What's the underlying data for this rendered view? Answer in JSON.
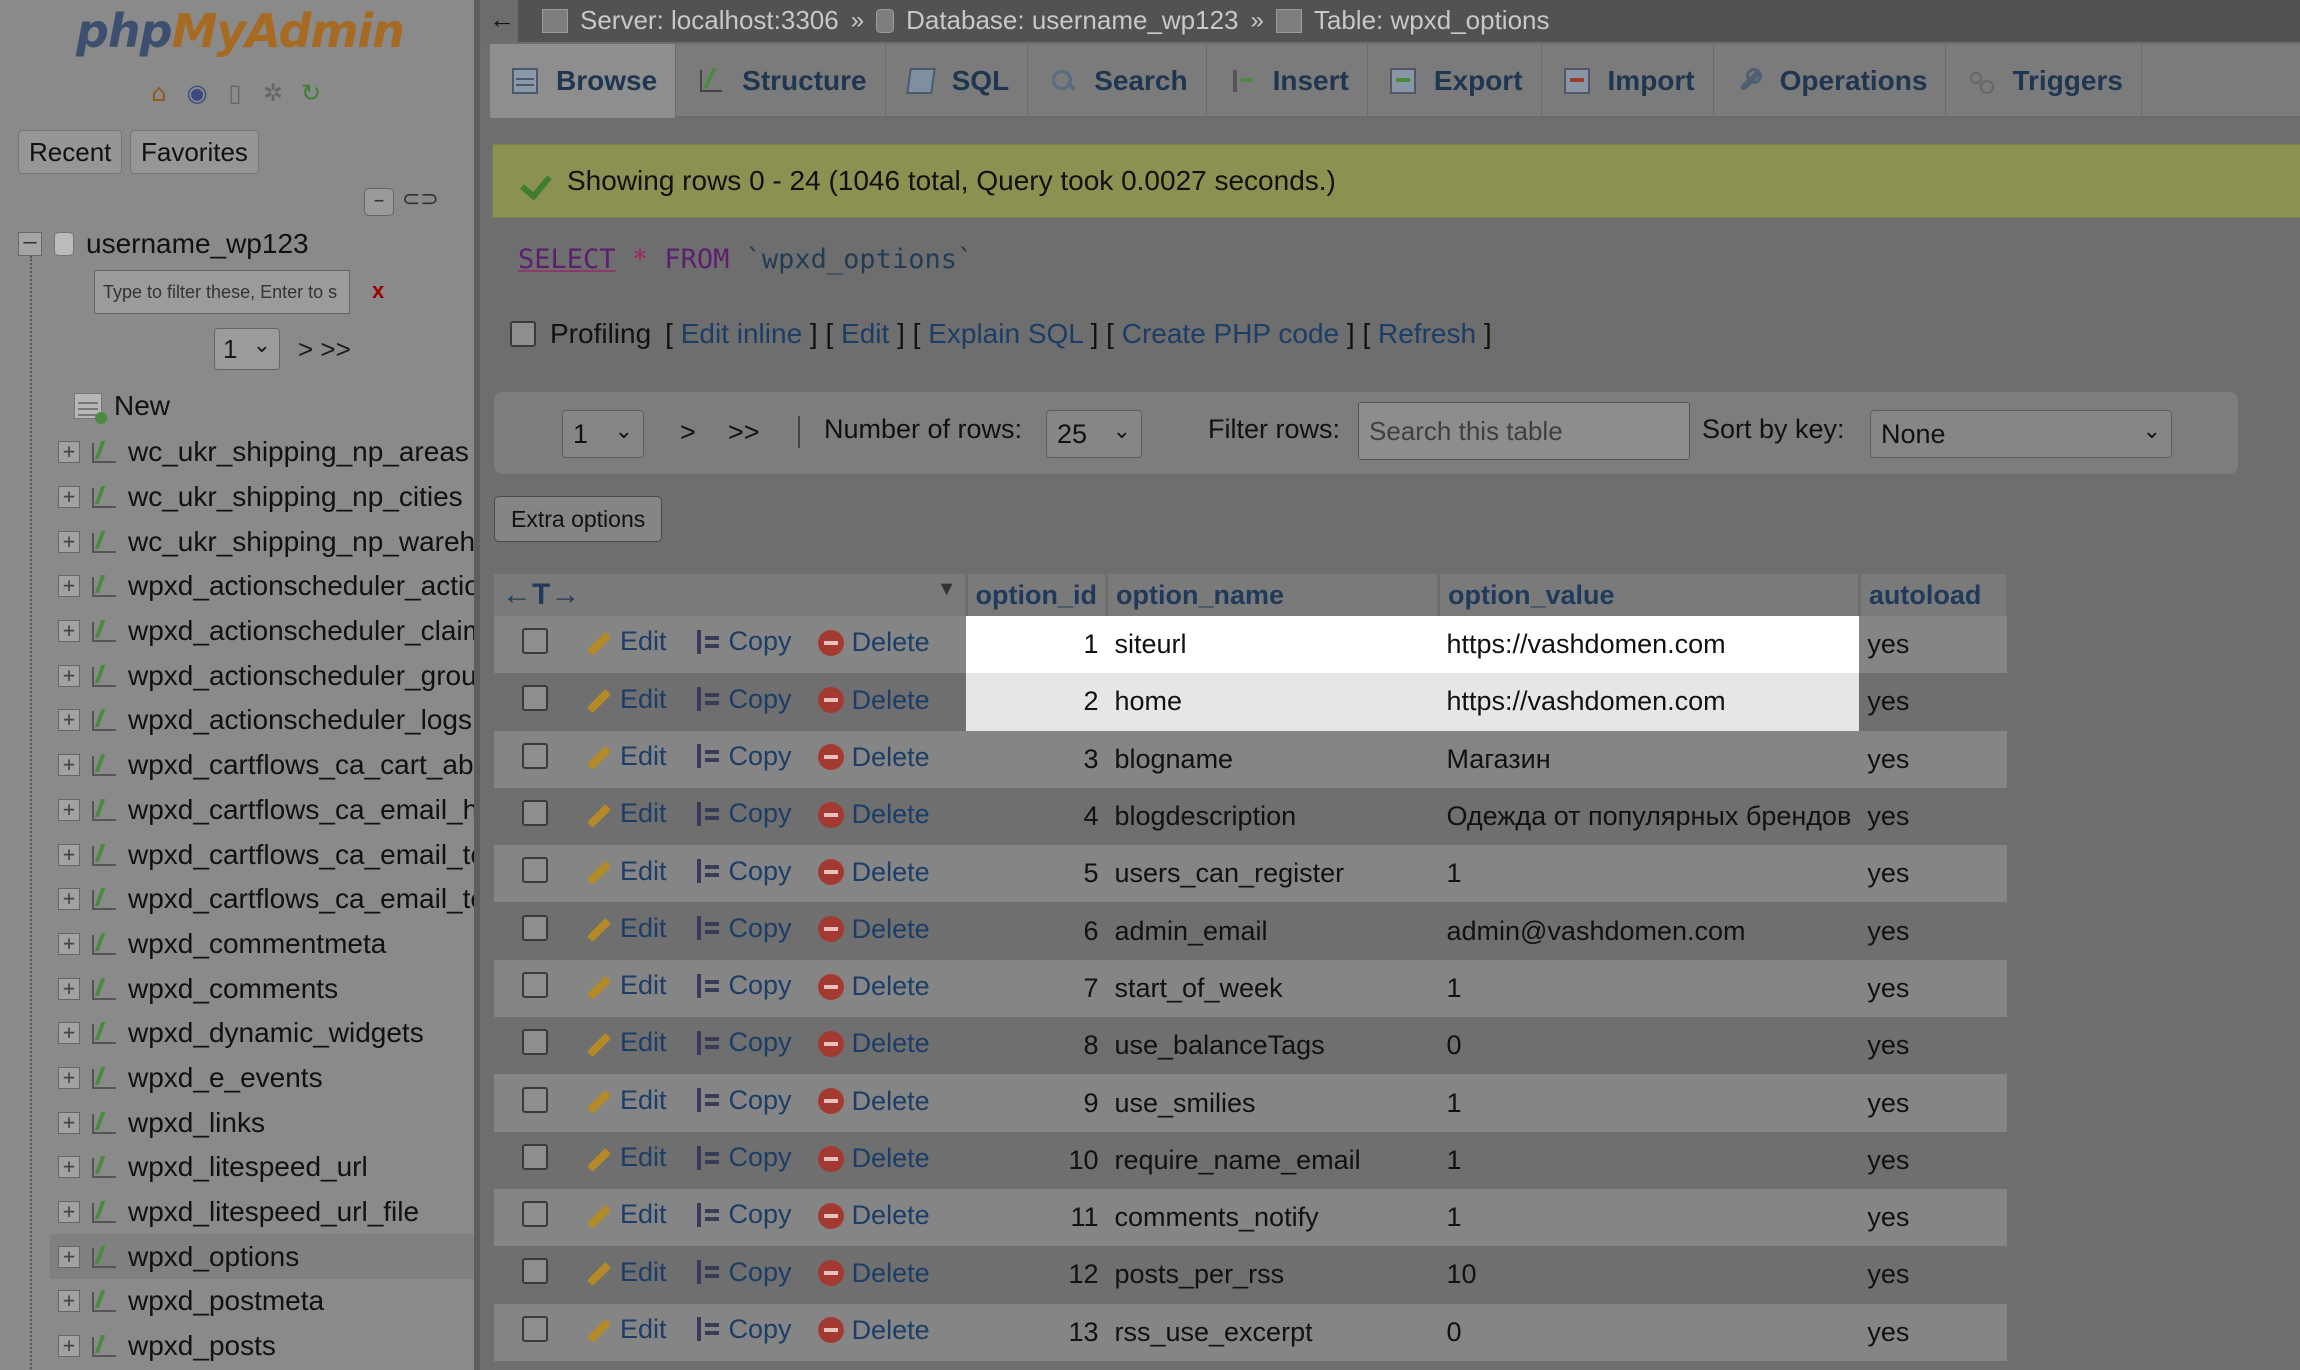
{
  "app": {
    "logo_part1": "php",
    "logo_part2": "MyAdmin"
  },
  "sidebar": {
    "recent_label": "Recent",
    "favorites_label": "Favorites",
    "db_name": "username_wp123",
    "filter_placeholder": "Type to filter these, Enter to s",
    "filter_clear": "x",
    "page_value": "1",
    "page_nav": "> >>",
    "new_label": "New",
    "tables": [
      "wc_ukr_shipping_np_areas",
      "wc_ukr_shipping_np_cities",
      "wc_ukr_shipping_np_warehouses",
      "wpxd_actionscheduler_actions",
      "wpxd_actionscheduler_claims",
      "wpxd_actionscheduler_groups",
      "wpxd_actionscheduler_logs",
      "wpxd_cartflows_ca_cart_abandonment",
      "wpxd_cartflows_ca_email_history",
      "wpxd_cartflows_ca_email_templates",
      "wpxd_cartflows_ca_email_templates_meta",
      "wpxd_commentmeta",
      "wpxd_comments",
      "wpxd_dynamic_widgets",
      "wpxd_e_events",
      "wpxd_links",
      "wpxd_litespeed_url",
      "wpxd_litespeed_url_file",
      "wpxd_options",
      "wpxd_postmeta",
      "wpxd_posts"
    ],
    "selected_table": "wpxd_options"
  },
  "breadcrumb": {
    "back": "←",
    "server": "Server: localhost:3306",
    "database": "Database: username_wp123",
    "table": "Table: wpxd_options",
    "sep": "»"
  },
  "tabs": [
    {
      "label": "Browse",
      "icon": "browse-icon"
    },
    {
      "label": "Structure",
      "icon": "structure-icon"
    },
    {
      "label": "SQL",
      "icon": "sql-icon"
    },
    {
      "label": "Search",
      "icon": "search-icon"
    },
    {
      "label": "Insert",
      "icon": "insert-icon"
    },
    {
      "label": "Export",
      "icon": "export-icon"
    },
    {
      "label": "Import",
      "icon": "import-icon"
    },
    {
      "label": "Operations",
      "icon": "wrench-icon"
    },
    {
      "label": "Triggers",
      "icon": "triggers-icon"
    }
  ],
  "result": {
    "message": "Showing rows 0 - 24 (1046 total, Query took 0.0027 seconds.)"
  },
  "sql": {
    "select": "SELECT",
    "star": "*",
    "from": "FROM",
    "table": "`wpxd_options`"
  },
  "profiling": {
    "label": "Profiling",
    "edit_inline": "Edit inline",
    "edit": "Edit",
    "explain": "Explain SQL",
    "create_php": "Create PHP code",
    "refresh": "Refresh"
  },
  "nav": {
    "page_value": "1",
    "next": ">",
    "last": ">>",
    "rows_label": "Number of rows:",
    "rows_value": "25",
    "filter_label": "Filter rows:",
    "search_placeholder": "Search this table",
    "sort_label": "Sort by key:",
    "sort_value": "None"
  },
  "extra_options": "Extra options",
  "table": {
    "arrows": "←T→",
    "columns": [
      "option_id",
      "option_name",
      "option_value",
      "autoload"
    ],
    "action_edit": "Edit",
    "action_copy": "Copy",
    "action_delete": "Delete",
    "rows": [
      {
        "id": "1",
        "name": "siteurl",
        "value": "https://vashdomen.com",
        "autoload": "yes"
      },
      {
        "id": "2",
        "name": "home",
        "value": "https://vashdomen.com",
        "autoload": "yes"
      },
      {
        "id": "3",
        "name": "blogname",
        "value": "Магазин",
        "autoload": "yes"
      },
      {
        "id": "4",
        "name": "blogdescription",
        "value": "Одежда от популярных брендов",
        "autoload": "yes"
      },
      {
        "id": "5",
        "name": "users_can_register",
        "value": "1",
        "autoload": "yes"
      },
      {
        "id": "6",
        "name": "admin_email",
        "value": "admin@vashdomen.com",
        "autoload": "yes"
      },
      {
        "id": "7",
        "name": "start_of_week",
        "value": "1",
        "autoload": "yes"
      },
      {
        "id": "8",
        "name": "use_balanceTags",
        "value": "0",
        "autoload": "yes"
      },
      {
        "id": "9",
        "name": "use_smilies",
        "value": "1",
        "autoload": "yes"
      },
      {
        "id": "10",
        "name": "require_name_email",
        "value": "1",
        "autoload": "yes"
      },
      {
        "id": "11",
        "name": "comments_notify",
        "value": "1",
        "autoload": "yes"
      },
      {
        "id": "12",
        "name": "posts_per_rss",
        "value": "10",
        "autoload": "yes"
      },
      {
        "id": "13",
        "name": "rss_use_excerpt",
        "value": "0",
        "autoload": "yes"
      }
    ]
  }
}
